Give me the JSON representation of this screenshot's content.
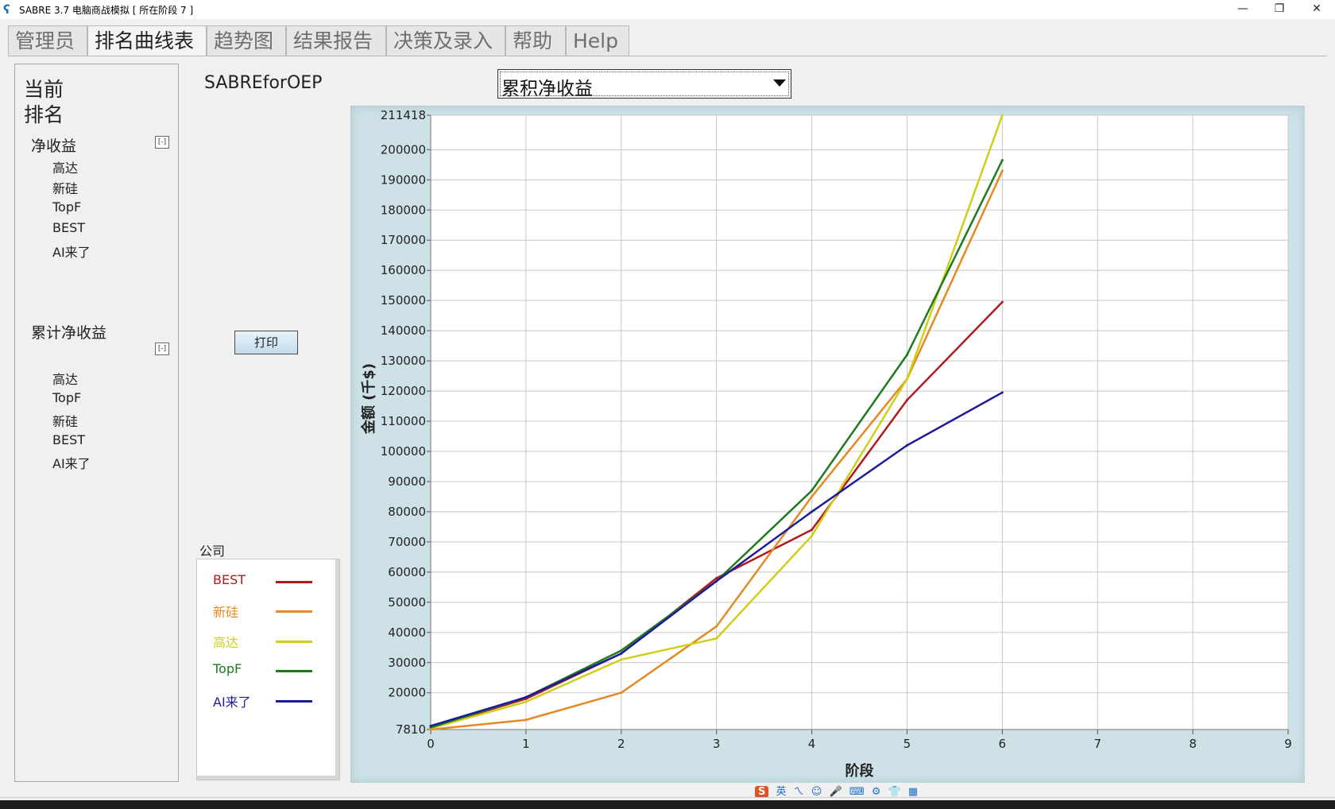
{
  "window": {
    "title": "SABRE 3.7 电脑商战模拟 [ 所在阶段 7 ]",
    "controls": {
      "minimize": "—",
      "restore": "❐",
      "close": "✕"
    }
  },
  "tabs": [
    {
      "label": "管理员",
      "active": false
    },
    {
      "label": "排名曲线表",
      "active": true
    },
    {
      "label": "趋势图",
      "active": false
    },
    {
      "label": "结果报告",
      "active": false
    },
    {
      "label": "决策及录入",
      "active": false
    },
    {
      "label": "帮助",
      "active": false
    },
    {
      "label": "Help",
      "active": false
    }
  ],
  "left_panel": {
    "heading_line1": "当前",
    "heading_line2": "排名",
    "collapse_symbol": "[-]",
    "net_income": {
      "title": "净收益",
      "items": [
        "高达",
        "新硅",
        "TopF",
        "BEST",
        "AI来了"
      ]
    },
    "cumulative": {
      "title": "累计净收益",
      "items": [
        "高达",
        "TopF",
        "新硅",
        "BEST",
        "AI来了"
      ]
    }
  },
  "main": {
    "game_name": "SABREforOEP",
    "print_button": "打印",
    "metric_select": {
      "value": "累积净收益"
    },
    "legend": {
      "title": "公司",
      "entries": [
        {
          "name": "BEST",
          "color": "#b0191e"
        },
        {
          "name": "新硅",
          "color": "#e58a22"
        },
        {
          "name": "高达",
          "color": "#cfcf1a"
        },
        {
          "name": "TopF",
          "color": "#1f7a1f"
        },
        {
          "name": "AI来了",
          "color": "#1c1c9a"
        }
      ]
    }
  },
  "chart_data": {
    "type": "line",
    "xlabel": "阶段",
    "ylabel": "金额 (千$)",
    "x": [
      0,
      1,
      2,
      3,
      4,
      5,
      6
    ],
    "xlim": [
      0,
      9
    ],
    "xticks": [
      "0",
      "1",
      "2",
      "3",
      "4",
      "5",
      "6",
      "7",
      "8",
      "9"
    ],
    "ylim": [
      7810,
      211418
    ],
    "yticks": [
      7810,
      20000,
      30000,
      40000,
      50000,
      60000,
      70000,
      80000,
      90000,
      100000,
      110000,
      120000,
      130000,
      140000,
      150000,
      160000,
      170000,
      180000,
      190000,
      200000,
      211418
    ],
    "grid": true,
    "series": [
      {
        "name": "BEST",
        "color": "#b0191e",
        "values": [
          8500,
          18000,
          33000,
          58000,
          74000,
          117000,
          149500
        ]
      },
      {
        "name": "新硅",
        "color": "#e58a22",
        "values": [
          7810,
          11000,
          20000,
          42000,
          85000,
          124000,
          193000
        ]
      },
      {
        "name": "高达",
        "color": "#cfcf1a",
        "values": [
          8200,
          17000,
          31000,
          38000,
          72000,
          124000,
          211418
        ]
      },
      {
        "name": "TopF",
        "color": "#1f7a1f",
        "values": [
          8500,
          18500,
          34000,
          57000,
          87000,
          132000,
          196500
        ]
      },
      {
        "name": "AI来了",
        "color": "#1c1c9a",
        "values": [
          9000,
          18500,
          33000,
          57000,
          80000,
          102000,
          119500
        ]
      }
    ]
  },
  "ime_toolbar": {
    "logo": "S",
    "mode": "英",
    "items": [
      "ㄟ",
      "☺",
      "🎤",
      "⌨",
      "⚙",
      "👕",
      "▦"
    ]
  }
}
